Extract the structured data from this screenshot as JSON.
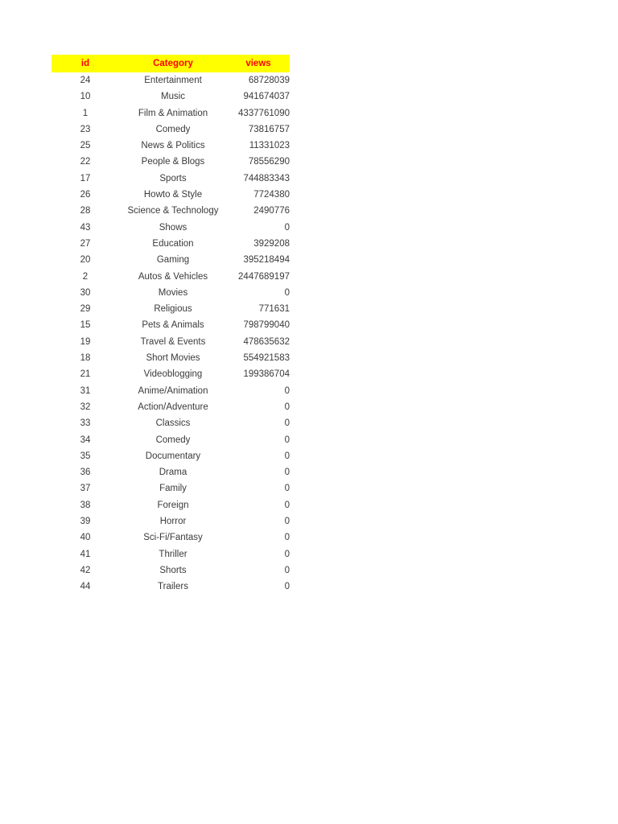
{
  "table": {
    "columns": [
      {
        "key": "id",
        "label": "id"
      },
      {
        "key": "category",
        "label": "Category"
      },
      {
        "key": "views",
        "label": "views"
      }
    ],
    "header_background_color": "#ffff00",
    "header_text_color": "#ff0000",
    "body_text_color": "#3a3a3a",
    "row_count": 31,
    "rows": [
      {
        "id": "24",
        "category": "Entertainment",
        "views": "68728039"
      },
      {
        "id": "10",
        "category": "Music",
        "views": "941674037"
      },
      {
        "id": "1",
        "category": "Film & Animation",
        "views": "4337761090"
      },
      {
        "id": "23",
        "category": "Comedy",
        "views": "73816757"
      },
      {
        "id": "25",
        "category": "News & Politics",
        "views": "11331023"
      },
      {
        "id": "22",
        "category": "People & Blogs",
        "views": "78556290"
      },
      {
        "id": "17",
        "category": "Sports",
        "views": "744883343"
      },
      {
        "id": "26",
        "category": "Howto & Style",
        "views": "7724380"
      },
      {
        "id": "28",
        "category": "Science & Technology",
        "views": "2490776"
      },
      {
        "id": "43",
        "category": "Shows",
        "views": "0"
      },
      {
        "id": "27",
        "category": "Education",
        "views": "3929208"
      },
      {
        "id": "20",
        "category": "Gaming",
        "views": "395218494"
      },
      {
        "id": "2",
        "category": "Autos & Vehicles",
        "views": "2447689197"
      },
      {
        "id": "30",
        "category": "Movies",
        "views": "0"
      },
      {
        "id": "29",
        "category": "Religious",
        "views": "771631"
      },
      {
        "id": "15",
        "category": "Pets & Animals",
        "views": "798799040"
      },
      {
        "id": "19",
        "category": "Travel & Events",
        "views": "478635632"
      },
      {
        "id": "18",
        "category": "Short Movies",
        "views": "554921583"
      },
      {
        "id": "21",
        "category": "Videoblogging",
        "views": "199386704"
      },
      {
        "id": "31",
        "category": "Anime/Animation",
        "views": "0"
      },
      {
        "id": "32",
        "category": "Action/Adventure",
        "views": "0"
      },
      {
        "id": "33",
        "category": "Classics",
        "views": "0"
      },
      {
        "id": "34",
        "category": "Comedy",
        "views": "0"
      },
      {
        "id": "35",
        "category": "Documentary",
        "views": "0"
      },
      {
        "id": "36",
        "category": "Drama",
        "views": "0"
      },
      {
        "id": "37",
        "category": "Family",
        "views": "0"
      },
      {
        "id": "38",
        "category": "Foreign",
        "views": "0"
      },
      {
        "id": "39",
        "category": "Horror",
        "views": "0"
      },
      {
        "id": "40",
        "category": "Sci-Fi/Fantasy",
        "views": "0"
      },
      {
        "id": "41",
        "category": "Thriller",
        "views": "0"
      },
      {
        "id": "42",
        "category": "Shorts",
        "views": "0"
      },
      {
        "id": "44",
        "category": "Trailers",
        "views": "0"
      }
    ]
  }
}
